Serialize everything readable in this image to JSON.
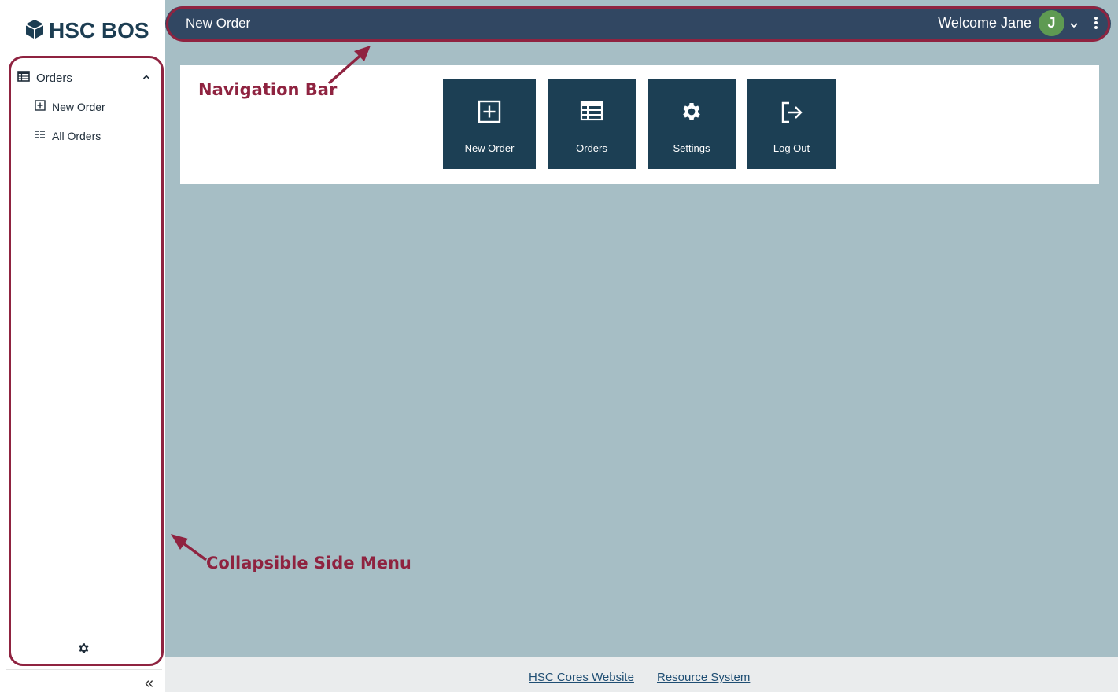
{
  "sidebar": {
    "logo_text": "HSC BOS",
    "group": {
      "label": "Orders",
      "icon": "table-icon",
      "expanded": true
    },
    "items": [
      {
        "label": "New Order",
        "icon": "plus-square-icon"
      },
      {
        "label": "All Orders",
        "icon": "list-icon"
      }
    ],
    "settings_icon": "gear-icon",
    "collapse_label": "«"
  },
  "topbar": {
    "title": "New Order",
    "welcome": "Welcome Jane",
    "avatar_initial": "J",
    "avatar_color": "#5e9a52"
  },
  "tiles": [
    {
      "label": "New Order",
      "icon": "plus-square-icon"
    },
    {
      "label": "Orders",
      "icon": "table-icon"
    },
    {
      "label": "Settings",
      "icon": "gear-icon"
    },
    {
      "label": "Log Out",
      "icon": "logout-icon"
    }
  ],
  "annotations": {
    "navigation_bar": "Navigation Bar",
    "side_menu": "Collapsible Side Menu"
  },
  "footer": {
    "links": [
      "HSC Cores Website",
      "Resource System"
    ]
  },
  "colors": {
    "accent": "#1c3f54",
    "topbar": "#314762",
    "annotation": "#8f2340",
    "background": "#a6bec5"
  }
}
